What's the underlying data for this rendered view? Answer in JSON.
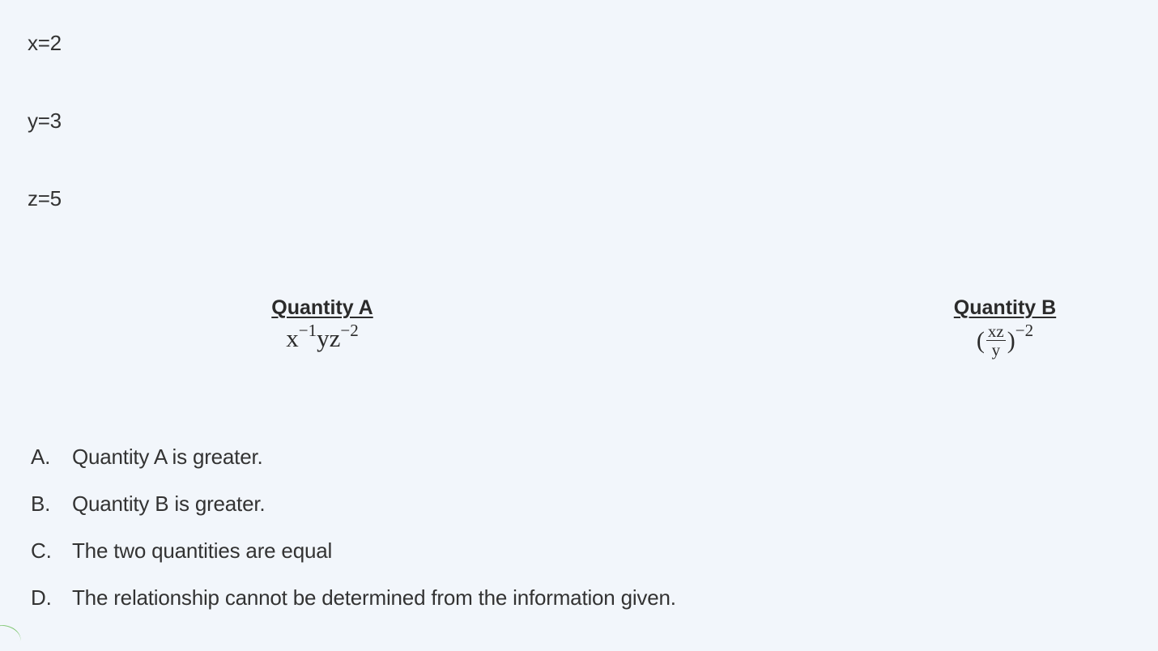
{
  "givens": [
    "x=2",
    "y=3",
    "z=5"
  ],
  "quantity_a": {
    "title": "Quantity A",
    "expr_x": "x",
    "exp_x": "−1",
    "expr_yz": "yz",
    "exp_z": "−2"
  },
  "quantity_b": {
    "title": "Quantity B",
    "open_paren": "(",
    "numerator": "xz",
    "denominator": "y",
    "close_paren": ")",
    "exponent": "−2"
  },
  "choices": [
    {
      "letter": "A.",
      "text": "Quantity A is greater."
    },
    {
      "letter": "B.",
      "text": "Quantity B is greater."
    },
    {
      "letter": "C.",
      "text": "The two quantities are equal"
    },
    {
      "letter": "D.",
      "text": "The relationship cannot be determined from the information given."
    }
  ]
}
